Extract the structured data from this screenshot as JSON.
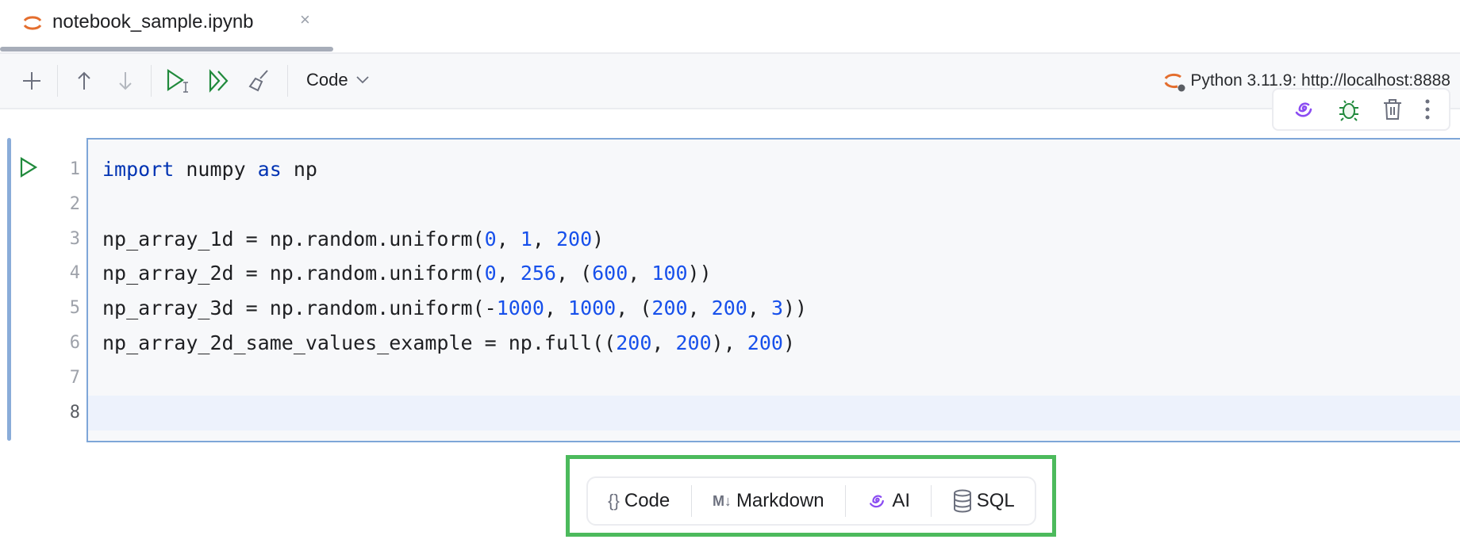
{
  "tab": {
    "title": "notebook_sample.ipynb",
    "close": "×"
  },
  "toolbar": {
    "cell_type": "Code",
    "kernel": "Python 3.11.9: http://localhost:8888"
  },
  "cell": {
    "lines": [
      {
        "n": "1",
        "html": "<span class=\"kw\">import</span> numpy <span class=\"kw\">as</span> np"
      },
      {
        "n": "2",
        "html": ""
      },
      {
        "n": "3",
        "html": "np_array_1d = np.random.uniform(<span class=\"num\">0</span>, <span class=\"num\">1</span>, <span class=\"num\">200</span>)"
      },
      {
        "n": "4",
        "html": "np_array_2d = np.random.uniform(<span class=\"num\">0</span>, <span class=\"num\">256</span>, (<span class=\"num\">600</span>, <span class=\"num\">100</span>))"
      },
      {
        "n": "5",
        "html": "np_array_3d = np.random.uniform(-<span class=\"num\">1000</span>, <span class=\"num\">1000</span>, (<span class=\"num\">200</span>, <span class=\"num\">200</span>, <span class=\"num\">3</span>))"
      },
      {
        "n": "6",
        "html": "np_array_2d_same_values_example = np.full((<span class=\"num\">200</span>, <span class=\"num\">200</span>), <span class=\"num\">200</span>)"
      },
      {
        "n": "7",
        "html": ""
      },
      {
        "n": "8",
        "html": ""
      }
    ],
    "active_line": 8
  },
  "add_cell": {
    "code": "Code",
    "markdown_icon": "M↓",
    "markdown": "Markdown",
    "ai": "AI",
    "sql": "SQL",
    "braces": "{}"
  },
  "colors": {
    "accent": "#7ea6d8",
    "run": "#208a3c",
    "ai": "#8b4cf2",
    "highlight": "#4cba5c"
  }
}
